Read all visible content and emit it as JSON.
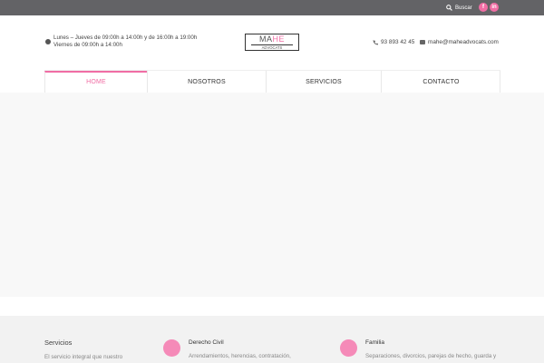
{
  "topbar": {
    "search_label": "Buscar",
    "social": [
      {
        "icon": "facebook-icon",
        "glyph": "f"
      },
      {
        "icon": "linkedin-icon",
        "glyph": "in"
      }
    ],
    "accent": "#f06da4"
  },
  "header": {
    "hours_line1": "Lunes – Jueves de 09:00h a 14:00h y de 16:00h a 19:00h",
    "hours_line2": "Viernes de 09:00h a 14:00h",
    "logo_ma": "MA",
    "logo_he": "HE",
    "logo_sub": "ADVOCATS",
    "phone": "93 893 42 45",
    "email": "mahe@maheadvocats.com"
  },
  "nav": {
    "items": [
      {
        "label": "HOME"
      },
      {
        "label": "NOSOTROS"
      },
      {
        "label": "SERVICIOS"
      },
      {
        "label": "CONTACTO"
      }
    ]
  },
  "footer": {
    "title": "Servicios",
    "intro": "El servicio integral que nuestro",
    "services": [
      {
        "title": "Derecho Civil",
        "text": "Arrendamientos, herencias, contratación,"
      },
      {
        "title": "Familia",
        "text": "Separaciones, divorcios, parejas de hecho, guarda y"
      }
    ]
  }
}
